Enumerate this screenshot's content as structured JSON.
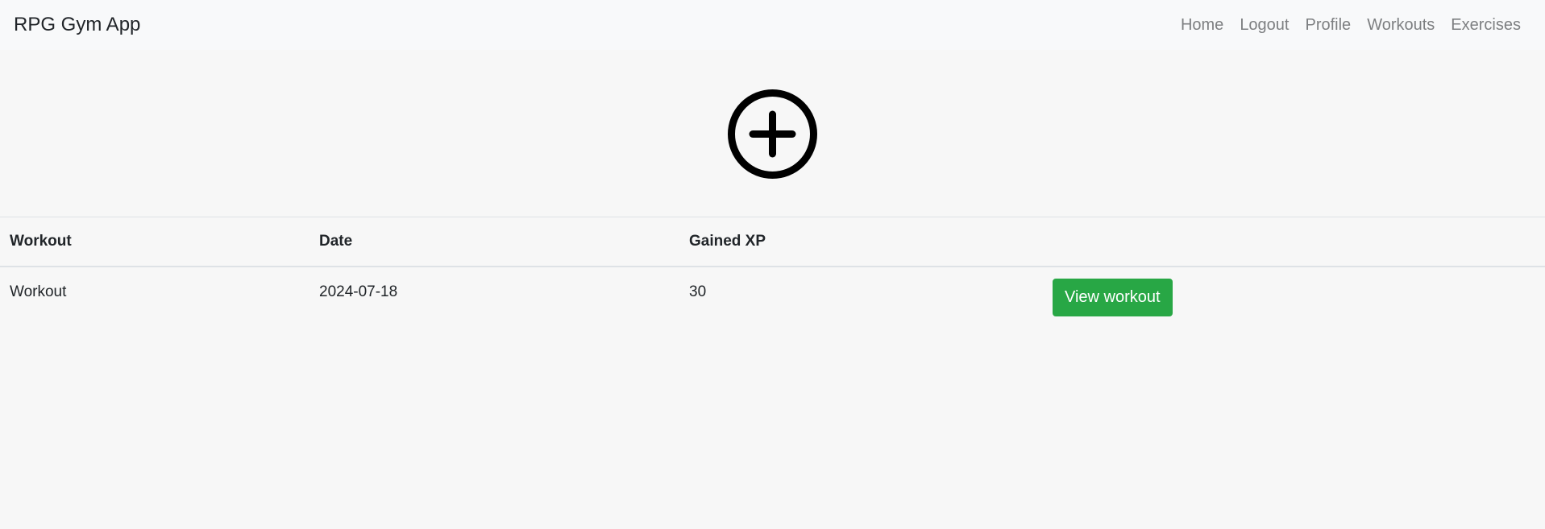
{
  "navbar": {
    "brand": "RPG Gym App",
    "links": [
      "Home",
      "Logout",
      "Profile",
      "Workouts",
      "Exercises"
    ]
  },
  "add_button": {
    "icon": "plus-circle-icon"
  },
  "table": {
    "headers": [
      "Workout",
      "Date",
      "Gained XP",
      ""
    ],
    "rows": [
      {
        "workout": "Workout",
        "date": "2024-07-18",
        "xp": "30",
        "action_label": "View workout"
      }
    ]
  },
  "colors": {
    "navbar_bg": "#f8f9fa",
    "page_bg": "#f7f7f7",
    "nav_link": "#7d7f81",
    "success_button": "#28a745"
  }
}
